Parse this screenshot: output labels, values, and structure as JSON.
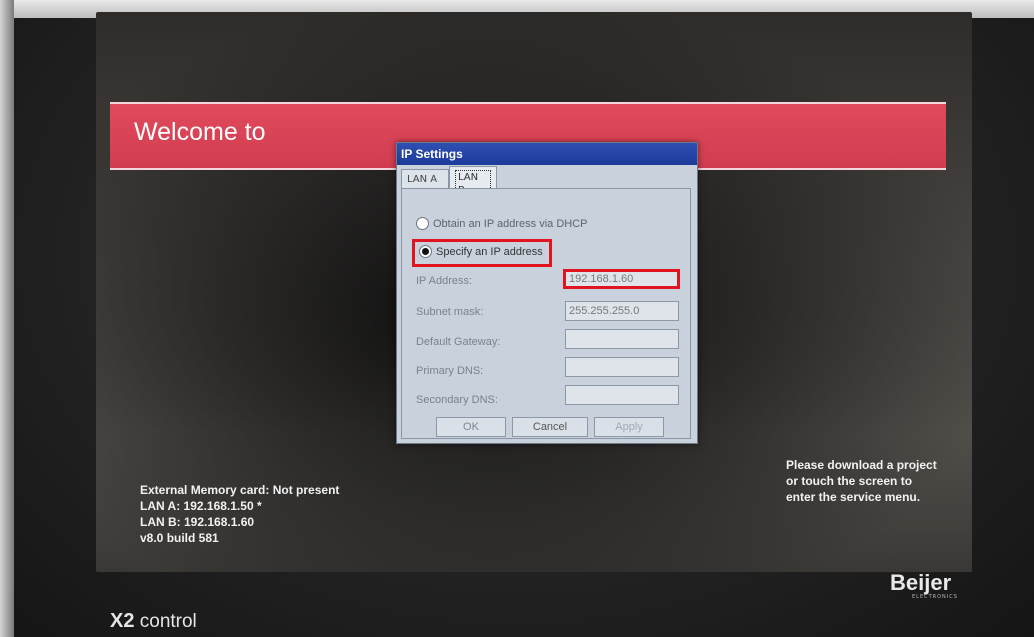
{
  "screen": {
    "welcome": "Welcome to",
    "left_info": [
      "External Memory card: Not present",
      "LAN A: 192.168.1.50 *",
      "LAN B: 192.168.1.60",
      "v8.0 build 581"
    ],
    "right_info": [
      "Please download a project",
      "or touch the screen to",
      "enter the service menu."
    ]
  },
  "dialog": {
    "title": "IP Settings",
    "tabs": [
      {
        "label": "LAN A",
        "active": false
      },
      {
        "label": "LAN B",
        "active": true
      }
    ],
    "radios": {
      "dhcp": "Obtain an IP address via DHCP",
      "specify": "Specify an IP address",
      "selected": "specify"
    },
    "fields": {
      "ip_label": "IP Address:",
      "ip_value": "192.168.1.60",
      "subnet_label": "Subnet mask:",
      "subnet_value": "255.255.255.0",
      "gateway_label": "Default Gateway:",
      "gateway_value": "",
      "primary_dns_label": "Primary DNS:",
      "primary_dns_value": "",
      "secondary_dns_label": "Secondary DNS:",
      "secondary_dns_value": ""
    },
    "buttons": {
      "ok": "OK",
      "cancel": "Cancel",
      "apply": "Apply"
    }
  },
  "device": {
    "brand": "Beijer",
    "brand_sub": "ELECTRONICS",
    "model_bold": "X2",
    "model_rest": " control"
  },
  "colors": {
    "banner": "#d23c50",
    "highlight": "#e0141e",
    "title_bar": "#1b3a9c"
  }
}
